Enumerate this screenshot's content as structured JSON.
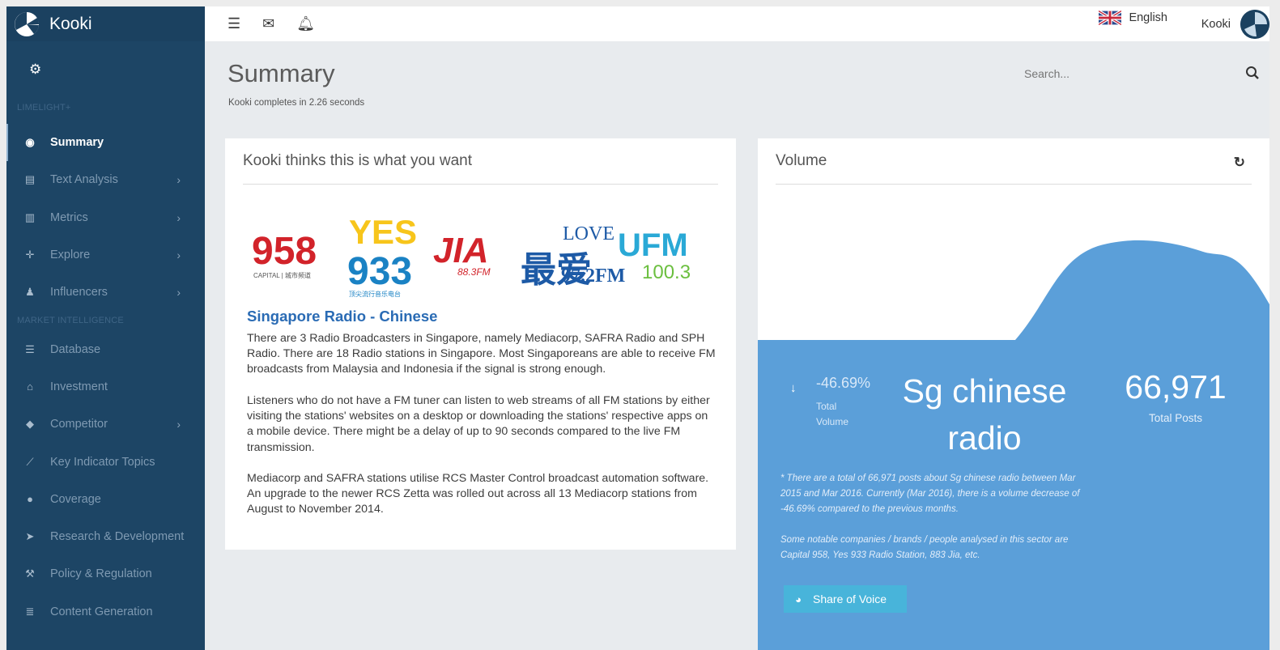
{
  "app": {
    "name": "Kooki"
  },
  "sidebar": {
    "sections": [
      "LIMELIGHT+",
      "MARKET INTELLIGENCE"
    ],
    "items": [
      {
        "label": "Summary",
        "icon": "dashboard-icon"
      },
      {
        "label": "Text Analysis",
        "icon": "document-icon"
      },
      {
        "label": "Metrics",
        "icon": "bar-chart-icon"
      },
      {
        "label": "Explore",
        "icon": "crosshair-icon"
      },
      {
        "label": "Influencers",
        "icon": "users-icon"
      },
      {
        "label": "Database",
        "icon": "database-icon"
      },
      {
        "label": "Investment",
        "icon": "bank-icon"
      },
      {
        "label": "Competitor",
        "icon": "tags-icon"
      },
      {
        "label": "Key Indicator Topics",
        "icon": "line-chart-icon"
      },
      {
        "label": "Coverage",
        "icon": "globe-icon"
      },
      {
        "label": "Research & Development",
        "icon": "rocket-icon"
      },
      {
        "label": "Policy & Regulation",
        "icon": "gavel-icon"
      },
      {
        "label": "Content Generation",
        "icon": "list-icon"
      }
    ]
  },
  "topbar": {
    "language": "English",
    "user": "Kooki"
  },
  "page": {
    "title": "Summary",
    "subtitle": "Kooki completes in 2.26 seconds",
    "search_placeholder": "Search..."
  },
  "left_card": {
    "title": "Kooki thinks this is what you want",
    "logos": {
      "capital": "958",
      "capital_sub": "CAPITAL | 城市频道",
      "yes_top": "YES",
      "yes_bottom": "933",
      "yes_sub": "顶尖流行音乐电台",
      "jia": "JIA",
      "jia_sub": "88.3FM",
      "love_cn": "最爱",
      "love_en": "LOVE",
      "love_freq": "97.2FM",
      "ufm": "UFM",
      "ufm_freq": "100.3"
    },
    "subhead": "Singapore Radio - Chinese",
    "p1": "There are 3 Radio Broadcasters in Singapore, namely Mediacorp, SAFRA Radio and SPH Radio. There are 18 Radio stations in Singapore. Most Singaporeans are able to receive FM broadcasts from Malaysia and Indonesia if the signal is strong enough.",
    "p2": "Listeners who do not have a FM tuner can listen to web streams of all FM stations by either visiting the stations' websites on a desktop or downloading the stations' respective apps on a mobile device. There might be a delay of up to 90 seconds compared to the live FM transmission.",
    "p3": "Mediacorp and SAFRA stations utilise RCS Master Control broadcast automation software. An upgrade to the newer RCS Zetta was rolled out across all 13 Mediacorp stations from August to November 2014."
  },
  "right_card": {
    "title": "Volume",
    "change_pct": "-46.69%",
    "change_label_1": "Total",
    "change_label_2": "Volume",
    "topic": "Sg chinese radio",
    "total_posts": "66,971",
    "total_posts_label": "Total Posts",
    "note1": "* There are a total of 66,971 posts about Sg chinese radio between Mar 2015 and Mar 2016. Currently (Mar 2016), there is a volume decrease of -46.69% compared to the previous months.",
    "note2": "Some notable companies / brands / people analysed in this sector are Capital 958, Yes 933 Radio Station, 883 Jia, etc.",
    "button": "Share of Voice"
  },
  "colors": {
    "sidebar": "#1d4565",
    "blue_panel": "#5b9fd9",
    "link": "#2a6bb4",
    "button": "#48b4da"
  }
}
